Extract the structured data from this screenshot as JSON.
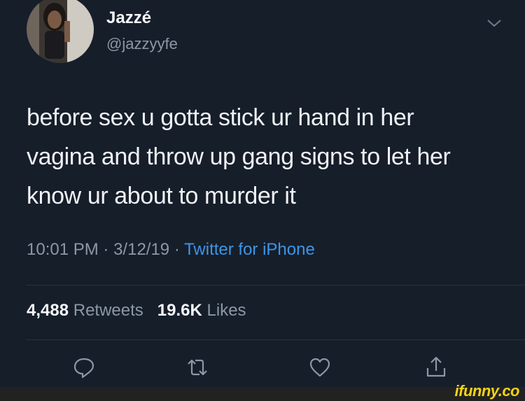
{
  "tweet": {
    "display_name": "Jazzé",
    "handle": "@jazzyyfe",
    "text": "before sex u gotta stick ur hand in her vagina and throw up gang signs to let her know ur about to murder it",
    "time": "10:01 PM",
    "date": "3/12/19",
    "separator": "·",
    "source": "Twitter for iPhone",
    "retweet_count": "4,488",
    "retweet_label": "Retweets",
    "like_count": "19.6K",
    "like_label": "Likes"
  },
  "icons": {
    "menu": "chevron-down-icon",
    "reply": "reply-icon",
    "retweet": "retweet-icon",
    "like": "heart-icon",
    "share": "share-icon"
  },
  "colors": {
    "background": "#161e2a",
    "link": "#3d95e6",
    "muted": "#8b98a5",
    "watermark": "#f4d316"
  },
  "watermark": "ifunny.co"
}
